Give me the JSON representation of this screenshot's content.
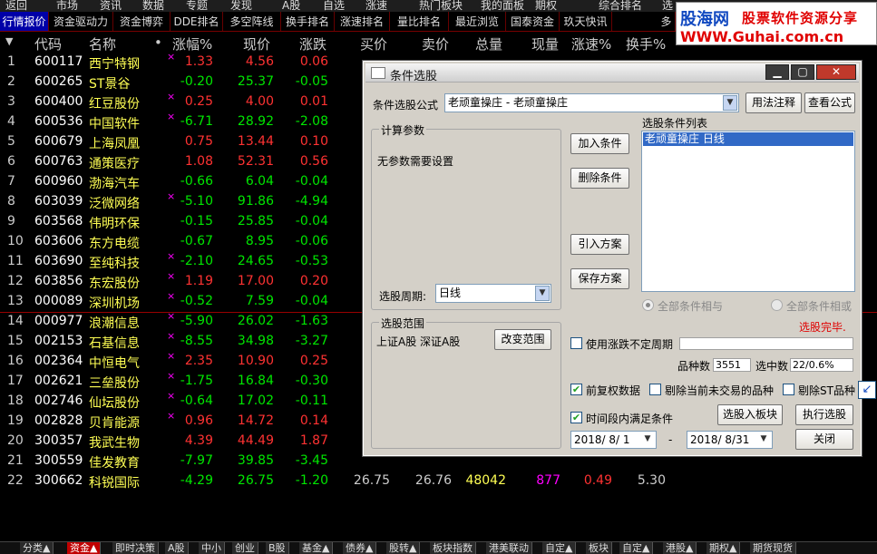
{
  "menubar": {
    "items": [
      "返回",
      "市场",
      "资讯",
      "数据",
      "专题",
      "发现",
      "A股",
      "自选",
      "涨速",
      "热门板块",
      "我的面板",
      "期权",
      "综合排名",
      "选"
    ]
  },
  "tabs": [
    "行情报价",
    "资金驱动力",
    "资金博弈",
    "DDE排名",
    "多空阵线",
    "换手排名",
    "涨速排名",
    "量比排名",
    "最近浏览",
    "国泰资金",
    "玖天快讯",
    "多"
  ],
  "logo": {
    "line1a": "股海网",
    "line1b": "股票软件资源分享",
    "line2": "WWW.Guhai.com.cn"
  },
  "columns": [
    "代码",
    "名称",
    "•",
    "涨幅%",
    "现价",
    "涨跌",
    "买价",
    "卖价",
    "总量",
    "现量",
    "涨速%",
    "换手%"
  ],
  "rows": [
    {
      "no": "1",
      "code": "600117",
      "name": "西宁特钢",
      "mark": "×",
      "pct": "1.33",
      "price": "4.56",
      "chg": "0.06",
      "up": 1
    },
    {
      "no": "2",
      "code": "600265",
      "name": "ST景谷",
      "mark": "",
      "pct": "-0.20",
      "price": "25.37",
      "chg": "-0.05",
      "up": 0
    },
    {
      "no": "3",
      "code": "600400",
      "name": "红豆股份",
      "mark": "×",
      "pct": "0.25",
      "price": "4.00",
      "chg": "0.01",
      "up": 1
    },
    {
      "no": "4",
      "code": "600536",
      "name": "中国软件",
      "mark": "×",
      "pct": "-6.71",
      "price": "28.92",
      "chg": "-2.08",
      "up": 0
    },
    {
      "no": "5",
      "code": "600679",
      "name": "上海凤凰",
      "mark": "",
      "pct": "0.75",
      "price": "13.44",
      "chg": "0.10",
      "up": 1
    },
    {
      "no": "6",
      "code": "600763",
      "name": "通策医疗",
      "mark": "",
      "pct": "1.08",
      "price": "52.31",
      "chg": "0.56",
      "up": 1
    },
    {
      "no": "7",
      "code": "600960",
      "name": "渤海汽车",
      "mark": "",
      "pct": "-0.66",
      "price": "6.04",
      "chg": "-0.04",
      "up": 0
    },
    {
      "no": "8",
      "code": "603039",
      "name": "泛微网络",
      "mark": "×",
      "pct": "-5.10",
      "price": "91.86",
      "chg": "-4.94",
      "up": 0
    },
    {
      "no": "9",
      "code": "603568",
      "name": "伟明环保",
      "mark": "",
      "pct": "-0.15",
      "price": "25.85",
      "chg": "-0.04",
      "up": 0
    },
    {
      "no": "10",
      "code": "603606",
      "name": "东方电缆",
      "mark": "",
      "pct": "-0.67",
      "price": "8.95",
      "chg": "-0.06",
      "up": 0
    },
    {
      "no": "11",
      "code": "603690",
      "name": "至纯科技",
      "mark": "×",
      "pct": "-2.10",
      "price": "24.65",
      "chg": "-0.53",
      "up": 0
    },
    {
      "no": "12",
      "code": "603856",
      "name": "东宏股份",
      "mark": "×",
      "pct": "1.19",
      "price": "17.00",
      "chg": "0.20",
      "up": 1
    },
    {
      "no": "13",
      "code": "000089",
      "name": "深圳机场",
      "mark": "×",
      "pct": "-0.52",
      "price": "7.59",
      "chg": "-0.04",
      "up": 0
    },
    {
      "no": "14",
      "code": "000977",
      "name": "浪潮信息",
      "mark": "×",
      "pct": "-5.90",
      "price": "26.02",
      "chg": "-1.63",
      "up": 0
    },
    {
      "no": "15",
      "code": "002153",
      "name": "石基信息",
      "mark": "×",
      "pct": "-8.55",
      "price": "34.98",
      "chg": "-3.27",
      "up": 0
    },
    {
      "no": "16",
      "code": "002364",
      "name": "中恒电气",
      "mark": "×",
      "pct": "2.35",
      "price": "10.90",
      "chg": "0.25",
      "up": 1
    },
    {
      "no": "17",
      "code": "002621",
      "name": "三垒股份",
      "mark": "×",
      "pct": "-1.75",
      "price": "16.84",
      "chg": "-0.30",
      "up": 0
    },
    {
      "no": "18",
      "code": "002746",
      "name": "仙坛股份",
      "mark": "×",
      "pct": "-0.64",
      "price": "17.02",
      "chg": "-0.11",
      "up": 0
    },
    {
      "no": "19",
      "code": "002828",
      "name": "贝肯能源",
      "mark": "×",
      "pct": "0.96",
      "price": "14.72",
      "chg": "0.14",
      "up": 1
    },
    {
      "no": "20",
      "code": "300357",
      "name": "我武生物",
      "mark": "",
      "pct": "4.39",
      "price": "44.49",
      "chg": "1.87",
      "up": 1
    },
    {
      "no": "21",
      "code": "300559",
      "name": "佳发教育",
      "mark": "",
      "pct": "-7.97",
      "price": "39.85",
      "chg": "-3.45",
      "up": 0
    },
    {
      "no": "22",
      "code": "300662",
      "name": "科锐国际",
      "mark": "",
      "pct": "-4.29",
      "price": "26.75",
      "chg": "-1.20",
      "up": 0,
      "bid": "26.75",
      "ask": "26.76",
      "vol": "48042",
      "cur": "877",
      "spd": "0.49",
      "turn": "5.30"
    }
  ],
  "bottom_tabs": [
    "分类▲",
    "资金▲",
    "即时决策",
    "A股",
    "中小",
    "创业",
    "B股",
    "基金▲",
    "债券▲",
    "股转▲",
    "板块指数",
    "港美联动",
    "自定▲",
    "板块",
    "自定▲",
    "港股▲",
    "期权▲",
    "期货现货"
  ],
  "dialog": {
    "title": "条件选股",
    "formula_label": "条件选股公式",
    "formula_value": "老顽童操庄   - 老顽童操庄",
    "btn_usage": "用法注释",
    "btn_view": "查看公式",
    "params_group": "计算参数",
    "params_text": "无参数需要设置",
    "list_label": "选股条件列表",
    "list_item": "老顽童操庄  日线",
    "btn_add": "加入条件",
    "btn_delete": "删除条件",
    "btn_import": "引入方案",
    "btn_save": "保存方案",
    "period_label": "选股周期:",
    "period_value": "日线",
    "radio_and": "全部条件相与",
    "radio_or": "全部条件相或",
    "status": "选股完毕.",
    "scope_group": "选股范围",
    "scope_text": "上证A股 深证A股",
    "btn_scope": "改变范围",
    "chk_uncertain": "使用涨跌不定周期",
    "count_label": "品种数",
    "count_value": "3551",
    "hit_label": "选中数",
    "hit_value": "22/0.6%",
    "chk_restore": "前复权数据",
    "chk_exclude_untraded": "剔除当前未交易的品种",
    "chk_exclude_st": "剔除ST品种",
    "chk_period": "时间段内满足条件",
    "btn_to_block": "选股入板块",
    "btn_run": "执行选股",
    "date_from": "2018/ 8/ 1",
    "date_sep": "-",
    "date_to": "2018/ 8/31",
    "btn_close": "关闭"
  },
  "colors": {
    "up": "#ff3232",
    "down": "#00e600",
    "code": "#ffffff",
    "name": "#ffff54",
    "dialog_bg": "#d4d0c8",
    "selection": "#3169c6",
    "status": "#e00000"
  }
}
